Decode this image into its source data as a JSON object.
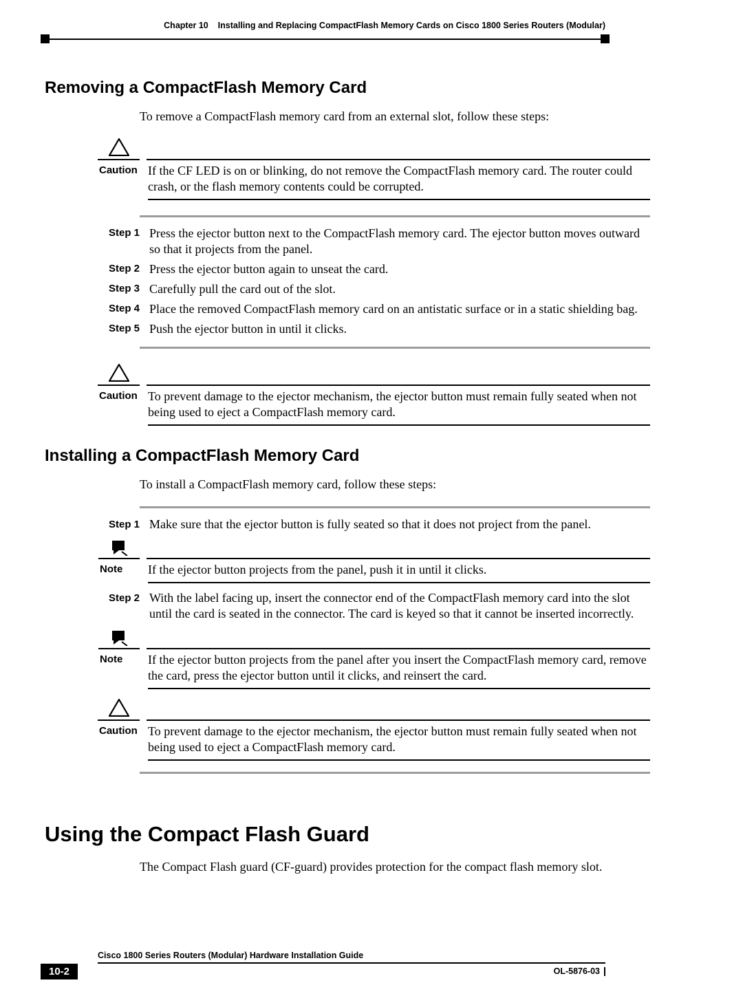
{
  "header": {
    "chapter_label": "Chapter 10",
    "chapter_title": "Installing and Replacing CompactFlash Memory Cards on Cisco 1800 Series Routers (Modular)"
  },
  "removing": {
    "heading": "Removing a CompactFlash Memory Card",
    "intro": "To remove a CompactFlash memory card from an external slot, follow these steps:",
    "caution1_label": "Caution",
    "caution1_text": "If the CF LED is on or blinking, do not remove the CompactFlash memory card. The router could crash, or the flash memory contents could be corrupted.",
    "steps": [
      {
        "label": "Step 1",
        "text": "Press the ejector button next to the CompactFlash memory card. The ejector button moves outward so that it projects from the panel."
      },
      {
        "label": "Step 2",
        "text": "Press the ejector button again to unseat the card."
      },
      {
        "label": "Step 3",
        "text": "Carefully pull the card out of the slot."
      },
      {
        "label": "Step 4",
        "text": "Place the removed CompactFlash memory card on an antistatic surface or in a static shielding bag."
      },
      {
        "label": "Step 5",
        "text": "Push the ejector button in until it clicks."
      }
    ],
    "caution2_label": "Caution",
    "caution2_text": "To prevent damage to the ejector mechanism, the ejector button must remain fully seated when not being used to eject a CompactFlash memory card."
  },
  "installing": {
    "heading": "Installing a CompactFlash Memory Card",
    "intro": "To install a CompactFlash memory card, follow these steps:",
    "step1_label": "Step 1",
    "step1_text": "Make sure that the ejector button is fully seated so that it does not project from the panel.",
    "note1_label": "Note",
    "note1_text": "If the ejector button projects from the panel, push it in until it clicks.",
    "step2_label": "Step 2",
    "step2_text": "With the label facing up, insert the connector end of the CompactFlash memory card into the slot until the card is seated in the connector. The card is keyed so that it cannot be inserted incorrectly.",
    "note2_label": "Note",
    "note2_text": "If the ejector button projects from the panel after you insert the CompactFlash memory card, remove the card, press the ejector button until it clicks, and reinsert the card.",
    "caution_label": "Caution",
    "caution_text": "To prevent damage to the ejector mechanism, the ejector button must remain fully seated when not being used to eject a CompactFlash memory card."
  },
  "guard": {
    "heading": "Using the Compact Flash Guard",
    "intro": "The Compact Flash guard (CF-guard) provides protection for the compact flash memory slot."
  },
  "footer": {
    "guide": "Cisco 1800 Series Routers (Modular) Hardware Installation Guide",
    "page": "10-2",
    "docnum": "OL-5876-03"
  }
}
